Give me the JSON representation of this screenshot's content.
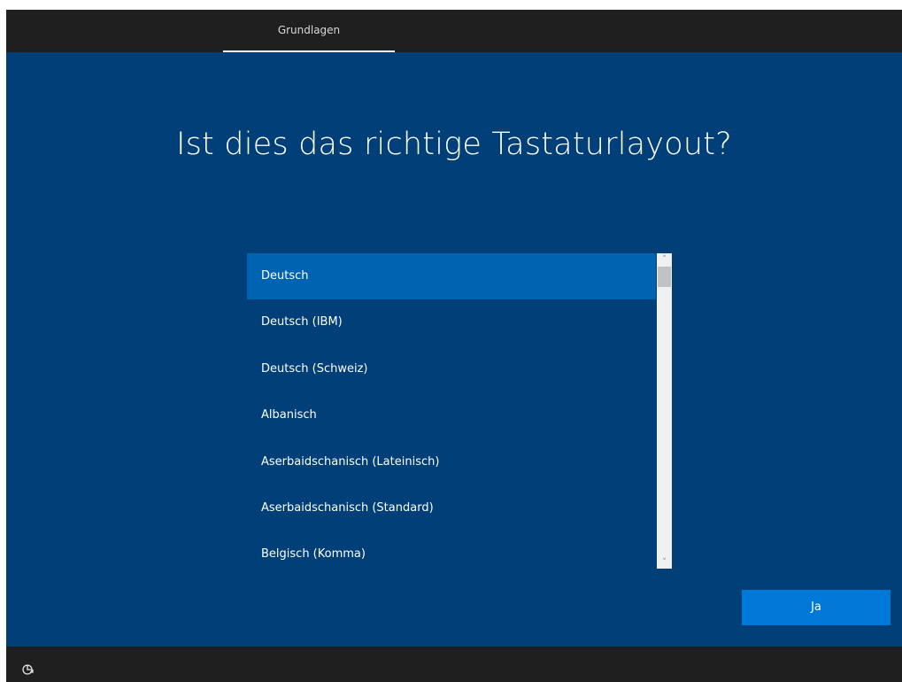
{
  "header": {
    "tab_label": "Grundlagen"
  },
  "main": {
    "title": "Ist dies das richtige Tastaturlayout?",
    "layouts": [
      {
        "label": "Deutsch",
        "selected": true
      },
      {
        "label": "Deutsch (IBM)",
        "selected": false
      },
      {
        "label": "Deutsch (Schweiz)",
        "selected": false
      },
      {
        "label": "Albanisch",
        "selected": false
      },
      {
        "label": "Aserbaidschanisch (Lateinisch)",
        "selected": false
      },
      {
        "label": "Aserbaidschanisch (Standard)",
        "selected": false
      },
      {
        "label": "Belgisch (Komma)",
        "selected": false
      }
    ],
    "confirm_label": "Ja"
  },
  "footer": {
    "accessibility_icon": "accessibility-icon"
  },
  "colors": {
    "background": "#003f78",
    "bar": "#1f1f1f",
    "selected_item": "#0063b1",
    "accent": "#0078d7"
  }
}
